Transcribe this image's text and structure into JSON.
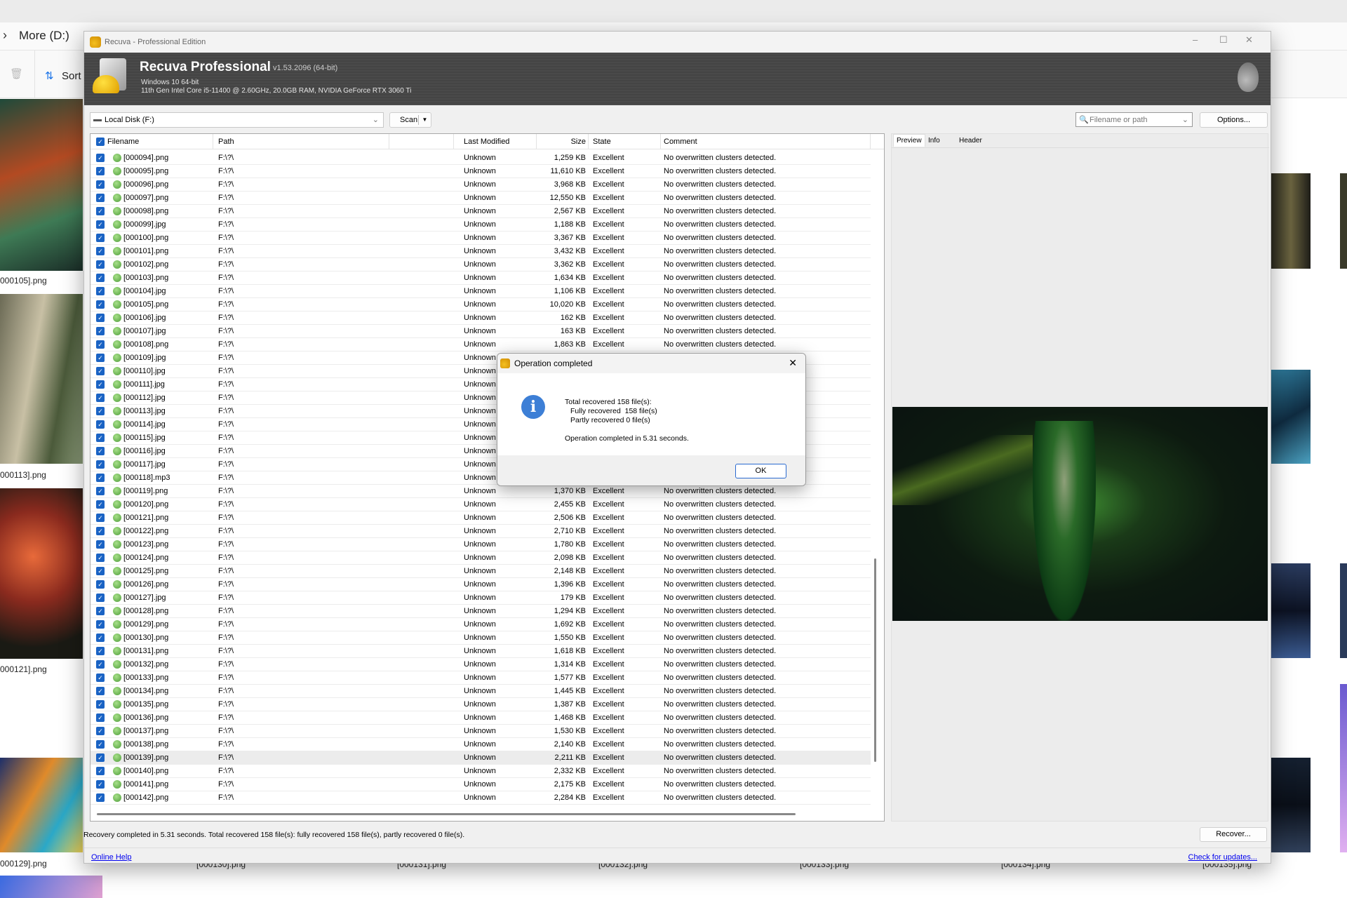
{
  "explorer": {
    "breadcrumb": "More (D:)",
    "sort_label": "Sort",
    "left_labels": [
      "000105].png",
      "000113].png",
      "000121].png",
      "000129].png"
    ],
    "bottom_labels": [
      "[000130].png",
      "[000131].png",
      "[000132].png",
      "[000133].png",
      "[000134].png",
      "[000135].png"
    ]
  },
  "window": {
    "title": "Recuva - Professional Edition",
    "controls": {
      "minimize": "–",
      "maximize": "☐",
      "close": "✕"
    }
  },
  "header": {
    "product": "Recuva Professional",
    "version": "v1.53.2096 (64-bit)",
    "os": "Windows 10 64-bit",
    "hardware": "11th Gen Intel Core i5-11400 @ 2.60GHz, 20.0GB RAM, NVIDIA GeForce RTX 3060 Ti"
  },
  "toolbar": {
    "drive": "Local Disk (F:)",
    "scan_label": "Scan",
    "filter_placeholder": "Filename or path",
    "options_label": "Options..."
  },
  "table": {
    "columns": [
      "Filename",
      "Path",
      "Last Modified",
      "Size",
      "State",
      "Comment"
    ],
    "rows": [
      [
        "[000094].png",
        "F:\\?\\",
        "Unknown",
        "1,259 KB",
        "Excellent",
        "No overwritten clusters detected."
      ],
      [
        "[000095].png",
        "F:\\?\\",
        "Unknown",
        "11,610 KB",
        "Excellent",
        "No overwritten clusters detected."
      ],
      [
        "[000096].png",
        "F:\\?\\",
        "Unknown",
        "3,968 KB",
        "Excellent",
        "No overwritten clusters detected."
      ],
      [
        "[000097].png",
        "F:\\?\\",
        "Unknown",
        "12,550 KB",
        "Excellent",
        "No overwritten clusters detected."
      ],
      [
        "[000098].png",
        "F:\\?\\",
        "Unknown",
        "2,567 KB",
        "Excellent",
        "No overwritten clusters detected."
      ],
      [
        "[000099].jpg",
        "F:\\?\\",
        "Unknown",
        "1,188 KB",
        "Excellent",
        "No overwritten clusters detected."
      ],
      [
        "[000100].png",
        "F:\\?\\",
        "Unknown",
        "3,367 KB",
        "Excellent",
        "No overwritten clusters detected."
      ],
      [
        "[000101].png",
        "F:\\?\\",
        "Unknown",
        "3,432 KB",
        "Excellent",
        "No overwritten clusters detected."
      ],
      [
        "[000102].png",
        "F:\\?\\",
        "Unknown",
        "3,362 KB",
        "Excellent",
        "No overwritten clusters detected."
      ],
      [
        "[000103].png",
        "F:\\?\\",
        "Unknown",
        "1,634 KB",
        "Excellent",
        "No overwritten clusters detected."
      ],
      [
        "[000104].jpg",
        "F:\\?\\",
        "Unknown",
        "1,106 KB",
        "Excellent",
        "No overwritten clusters detected."
      ],
      [
        "[000105].png",
        "F:\\?\\",
        "Unknown",
        "10,020 KB",
        "Excellent",
        "No overwritten clusters detected."
      ],
      [
        "[000106].jpg",
        "F:\\?\\",
        "Unknown",
        "162 KB",
        "Excellent",
        "No overwritten clusters detected."
      ],
      [
        "[000107].jpg",
        "F:\\?\\",
        "Unknown",
        "163 KB",
        "Excellent",
        "No overwritten clusters detected."
      ],
      [
        "[000108].png",
        "F:\\?\\",
        "Unknown",
        "1,863 KB",
        "Excellent",
        "No overwritten clusters detected."
      ],
      [
        "[000109].jpg",
        "F:\\?\\",
        "Unknown",
        "",
        "",
        ""
      ],
      [
        "[000110].jpg",
        "F:\\?\\",
        "Unknown",
        "",
        "",
        ""
      ],
      [
        "[000111].jpg",
        "F:\\?\\",
        "Unknown",
        "",
        "",
        ""
      ],
      [
        "[000112].jpg",
        "F:\\?\\",
        "Unknown",
        "",
        "",
        ""
      ],
      [
        "[000113].jpg",
        "F:\\?\\",
        "Unknown",
        "",
        "",
        ""
      ],
      [
        "[000114].jpg",
        "F:\\?\\",
        "Unknown",
        "",
        "",
        ""
      ],
      [
        "[000115].jpg",
        "F:\\?\\",
        "Unknown",
        "",
        "",
        ""
      ],
      [
        "[000116].jpg",
        "F:\\?\\",
        "Unknown",
        "",
        "",
        ""
      ],
      [
        "[000117].jpg",
        "F:\\?\\",
        "Unknown",
        "",
        "",
        ""
      ],
      [
        "[000118].mp3",
        "F:\\?\\",
        "Unknown",
        "",
        "",
        ""
      ],
      [
        "[000119].png",
        "F:\\?\\",
        "Unknown",
        "1,370 KB",
        "Excellent",
        "No overwritten clusters detected."
      ],
      [
        "[000120].png",
        "F:\\?\\",
        "Unknown",
        "2,455 KB",
        "Excellent",
        "No overwritten clusters detected."
      ],
      [
        "[000121].png",
        "F:\\?\\",
        "Unknown",
        "2,506 KB",
        "Excellent",
        "No overwritten clusters detected."
      ],
      [
        "[000122].png",
        "F:\\?\\",
        "Unknown",
        "2,710 KB",
        "Excellent",
        "No overwritten clusters detected."
      ],
      [
        "[000123].png",
        "F:\\?\\",
        "Unknown",
        "1,780 KB",
        "Excellent",
        "No overwritten clusters detected."
      ],
      [
        "[000124].png",
        "F:\\?\\",
        "Unknown",
        "2,098 KB",
        "Excellent",
        "No overwritten clusters detected."
      ],
      [
        "[000125].png",
        "F:\\?\\",
        "Unknown",
        "2,148 KB",
        "Excellent",
        "No overwritten clusters detected."
      ],
      [
        "[000126].png",
        "F:\\?\\",
        "Unknown",
        "1,396 KB",
        "Excellent",
        "No overwritten clusters detected."
      ],
      [
        "[000127].jpg",
        "F:\\?\\",
        "Unknown",
        "179 KB",
        "Excellent",
        "No overwritten clusters detected."
      ],
      [
        "[000128].png",
        "F:\\?\\",
        "Unknown",
        "1,294 KB",
        "Excellent",
        "No overwritten clusters detected."
      ],
      [
        "[000129].png",
        "F:\\?\\",
        "Unknown",
        "1,692 KB",
        "Excellent",
        "No overwritten clusters detected."
      ],
      [
        "[000130].png",
        "F:\\?\\",
        "Unknown",
        "1,550 KB",
        "Excellent",
        "No overwritten clusters detected."
      ],
      [
        "[000131].png",
        "F:\\?\\",
        "Unknown",
        "1,618 KB",
        "Excellent",
        "No overwritten clusters detected."
      ],
      [
        "[000132].png",
        "F:\\?\\",
        "Unknown",
        "1,314 KB",
        "Excellent",
        "No overwritten clusters detected."
      ],
      [
        "[000133].png",
        "F:\\?\\",
        "Unknown",
        "1,577 KB",
        "Excellent",
        "No overwritten clusters detected."
      ],
      [
        "[000134].png",
        "F:\\?\\",
        "Unknown",
        "1,445 KB",
        "Excellent",
        "No overwritten clusters detected."
      ],
      [
        "[000135].png",
        "F:\\?\\",
        "Unknown",
        "1,387 KB",
        "Excellent",
        "No overwritten clusters detected."
      ],
      [
        "[000136].png",
        "F:\\?\\",
        "Unknown",
        "1,468 KB",
        "Excellent",
        "No overwritten clusters detected."
      ],
      [
        "[000137].png",
        "F:\\?\\",
        "Unknown",
        "1,530 KB",
        "Excellent",
        "No overwritten clusters detected."
      ],
      [
        "[000138].png",
        "F:\\?\\",
        "Unknown",
        "2,140 KB",
        "Excellent",
        "No overwritten clusters detected."
      ],
      [
        "[000139].png",
        "F:\\?\\",
        "Unknown",
        "2,211 KB",
        "Excellent",
        "No overwritten clusters detected."
      ],
      [
        "[000140].png",
        "F:\\?\\",
        "Unknown",
        "2,332 KB",
        "Excellent",
        "No overwritten clusters detected."
      ],
      [
        "[000141].png",
        "F:\\?\\",
        "Unknown",
        "2,175 KB",
        "Excellent",
        "No overwritten clusters detected."
      ],
      [
        "[000142].png",
        "F:\\?\\",
        "Unknown",
        "2,284 KB",
        "Excellent",
        "No overwritten clusters detected."
      ]
    ],
    "highlighted_row": "[000139].png"
  },
  "preview_tabs": [
    "Preview",
    "Info",
    "Header"
  ],
  "status_text": "Recovery completed in 5.31 seconds. Total recovered 158 file(s): fully recovered 158 file(s), partly recovered 0 file(s).",
  "recover_label": "Recover...",
  "footer": {
    "online_help": "Online Help",
    "check_updates": "Check for updates..."
  },
  "dialog": {
    "title": "Operation completed",
    "line1": "Total recovered 158 file(s):",
    "line2": "Fully recovered  158 file(s)",
    "line3": "Partly recovered 0 file(s)",
    "line4": "Operation completed in 5.31 seconds.",
    "ok_label": "OK",
    "close": "✕"
  },
  "colors": {
    "accent": "#1a63c4",
    "header_bg": "#474747",
    "state_ok": "#5aab44",
    "info_icon": "#3d7fd6",
    "link": "#0000ee"
  }
}
